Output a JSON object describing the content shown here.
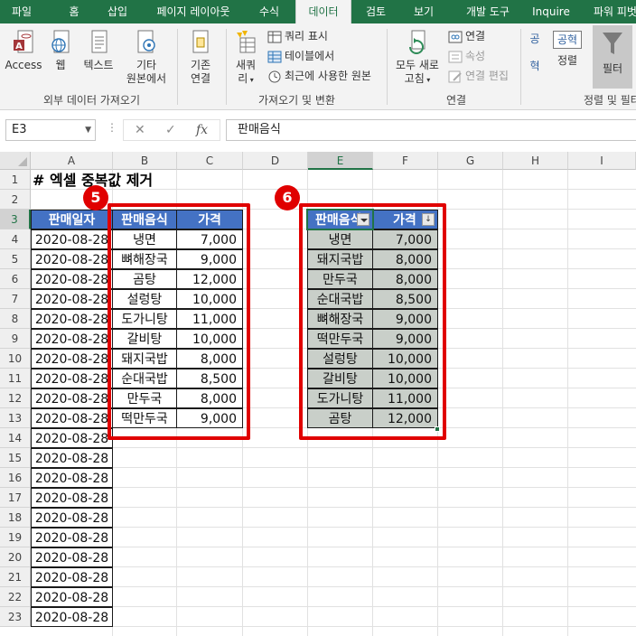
{
  "tabs": [
    "파일",
    "홈",
    "삽입",
    "페이지 레이아웃",
    "수식",
    "데이터",
    "검토",
    "보기",
    "개발 도구",
    "Inquire",
    "파워 피벗"
  ],
  "ribbon": {
    "access": "Access",
    "web": "웹",
    "text": "텍스트",
    "other1": "기타",
    "other2": "원본에서",
    "existing1": "기존",
    "existing2": "연결",
    "group_external": "외부 데이터 가져오기",
    "newquery1": "새쿼",
    "newquery2": "리",
    "show_query": "쿼리 표시",
    "from_table": "테이블에서",
    "recent_sources": "최근에 사용한 원본",
    "group_transform": "가져오기 및 변환",
    "refresh1": "모두 새로",
    "refresh2": "고침",
    "connections": "연결",
    "properties": "속성",
    "edit_links": "연결 편집",
    "group_connections": "연결",
    "sort": "정렬",
    "filter": "필터",
    "group_sortfilter": "정렬 및 필터",
    "sort_az": "공",
    "sort_desc": "공혁",
    "sort_za": "혁"
  },
  "formula": {
    "namebox": "E3",
    "value": "판매음식"
  },
  "columns": [
    "A",
    "B",
    "C",
    "D",
    "E",
    "F",
    "G",
    "H",
    "I"
  ],
  "rows": [
    "1",
    "2",
    "3",
    "4",
    "5",
    "6",
    "7",
    "8",
    "9",
    "10",
    "11",
    "12",
    "13",
    "14",
    "15",
    "16",
    "17",
    "18",
    "19",
    "20",
    "21",
    "22",
    "23"
  ],
  "title": "# 엑셀 중복값 제거",
  "badges": {
    "left": "5",
    "right": "6"
  },
  "table_a": {
    "header": "판매일자",
    "dates": [
      "2020-08-28",
      "2020-08-28",
      "2020-08-28",
      "2020-08-28",
      "2020-08-28",
      "2020-08-28",
      "2020-08-28",
      "2020-08-28",
      "2020-08-28",
      "2020-08-28",
      "2020-08-28",
      "2020-08-28",
      "2020-08-28",
      "2020-08-28",
      "2020-08-28",
      "2020-08-28",
      "2020-08-28",
      "2020-08-28",
      "2020-08-28",
      "2020-08-28"
    ]
  },
  "table_bc": {
    "headers": [
      "판매음식",
      "가격"
    ],
    "rows": [
      [
        "냉면",
        "7,000"
      ],
      [
        "뼈해장국",
        "9,000"
      ],
      [
        "곰탕",
        "12,000"
      ],
      [
        "설렁탕",
        "10,000"
      ],
      [
        "도가니탕",
        "11,000"
      ],
      [
        "갈비탕",
        "10,000"
      ],
      [
        "돼지국밥",
        "8,000"
      ],
      [
        "순대국밥",
        "8,500"
      ],
      [
        "만두국",
        "8,000"
      ],
      [
        "떡만두국",
        "9,000"
      ]
    ]
  },
  "table_ef": {
    "headers": [
      "판매음식",
      "가격"
    ],
    "rows": [
      [
        "냉면",
        "7,000"
      ],
      [
        "돼지국밥",
        "8,000"
      ],
      [
        "만두국",
        "8,000"
      ],
      [
        "순대국밥",
        "8,500"
      ],
      [
        "뼈해장국",
        "9,000"
      ],
      [
        "떡만두국",
        "9,000"
      ],
      [
        "설렁탕",
        "10,000"
      ],
      [
        "갈비탕",
        "10,000"
      ],
      [
        "도가니탕",
        "11,000"
      ],
      [
        "곰탕",
        "12,000"
      ]
    ]
  },
  "colors": {
    "excel_green": "#217346",
    "header_blue": "#4472c4",
    "highlight_red": "#e00000",
    "filtered_gray": "#c9cfc9"
  }
}
